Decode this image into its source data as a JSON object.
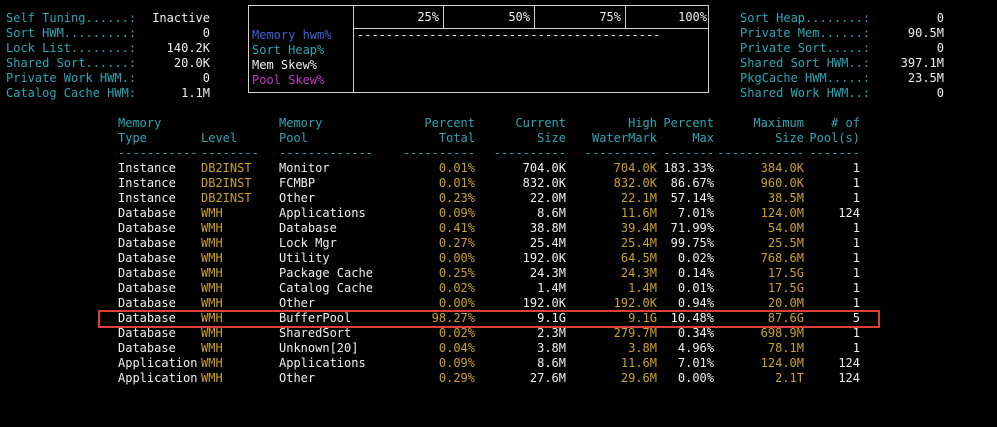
{
  "left_stats": [
    {
      "label": "Self Tuning......:",
      "value": "Inactive"
    },
    {
      "label": "Sort HWM.........:",
      "value": "0"
    },
    {
      "label": "Lock List........:",
      "value": "140.2K"
    },
    {
      "label": "Shared Sort......:",
      "value": "20.0K"
    },
    {
      "label": "Private Work HWM.:",
      "value": "0"
    },
    {
      "label": "Catalog Cache HWM:",
      "value": "1.1M"
    }
  ],
  "center_box": {
    "scale": [
      "25%",
      "50%",
      "75%",
      "100%"
    ],
    "legend": [
      {
        "label": "Memory hwm%",
        "color": "#3f63d6"
      },
      {
        "label": "Sort Heap%",
        "color": "#2aa7b3"
      },
      {
        "label": "Mem Skew%",
        "color": "#f0f0f0"
      },
      {
        "label": "Pool Skew%",
        "color": "#c238c2"
      }
    ],
    "hwm_bar": "------------------------------------------"
  },
  "right_stats": [
    {
      "label": "Sort Heap........:",
      "value": "0"
    },
    {
      "label": "Private Mem......:",
      "value": "90.5M"
    },
    {
      "label": "Private Sort.....:",
      "value": "0"
    },
    {
      "label": "Shared Sort HWM..:",
      "value": "397.1M"
    },
    {
      "label": "PkgCache HWM.....:",
      "value": "23.5M"
    },
    {
      "label": "Shared Work HWM..:",
      "value": "0"
    }
  ],
  "table": {
    "headers": [
      {
        "l1": "Memory",
        "l2": "Type"
      },
      {
        "l1": "",
        "l2": "Level"
      },
      {
        "l1": "Memory",
        "l2": "Pool"
      },
      {
        "l1": "Percent",
        "l2": "Total"
      },
      {
        "l1": "Current",
        "l2": "Size"
      },
      {
        "l1": "High",
        "l2": "WaterMark"
      },
      {
        "l1": "Percent",
        "l2": "Max"
      },
      {
        "l1": "Maximum",
        "l2": "Size"
      },
      {
        "l1": "# of",
        "l2": "Pool(s)"
      }
    ],
    "separators": [
      "-----------",
      "--------",
      "-------------",
      "----------",
      "----------",
      "----------",
      "-------",
      "------------",
      "-------"
    ],
    "rows": [
      [
        "Instance",
        "DB2INST",
        "Monitor",
        "0.01%",
        "704.0K",
        "704.0K",
        "183.33%",
        "384.0K",
        "1"
      ],
      [
        "Instance",
        "DB2INST",
        "FCMBP",
        "0.01%",
        "832.0K",
        "832.0K",
        "86.67%",
        "960.0K",
        "1"
      ],
      [
        "Instance",
        "DB2INST",
        "Other",
        "0.23%",
        "22.0M",
        "22.1M",
        "57.14%",
        "38.5M",
        "1"
      ],
      [
        "Database",
        "WMH",
        "Applications",
        "0.09%",
        "8.6M",
        "11.6M",
        "7.01%",
        "124.0M",
        "124"
      ],
      [
        "Database",
        "WMH",
        "Database",
        "0.41%",
        "38.8M",
        "39.4M",
        "71.99%",
        "54.0M",
        "1"
      ],
      [
        "Database",
        "WMH",
        "Lock Mgr",
        "0.27%",
        "25.4M",
        "25.4M",
        "99.75%",
        "25.5M",
        "1"
      ],
      [
        "Database",
        "WMH",
        "Utility",
        "0.00%",
        "192.0K",
        "64.5M",
        "0.02%",
        "768.6M",
        "1"
      ],
      [
        "Database",
        "WMH",
        "Package Cache",
        "0.25%",
        "24.3M",
        "24.3M",
        "0.14%",
        "17.5G",
        "1"
      ],
      [
        "Database",
        "WMH",
        "Catalog Cache",
        "0.02%",
        "1.4M",
        "1.4M",
        "0.01%",
        "17.5G",
        "1"
      ],
      [
        "Database",
        "WMH",
        "Other",
        "0.00%",
        "192.0K",
        "192.0K",
        "0.94%",
        "20.0M",
        "1"
      ],
      [
        "Database",
        "WMH",
        "BufferPool",
        "98.27%",
        "9.1G",
        "9.1G",
        "10.48%",
        "87.6G",
        "5"
      ],
      [
        "Database",
        "WMH",
        "SharedSort",
        "0.02%",
        "2.3M",
        "279.7M",
        "0.34%",
        "698.9M",
        "1"
      ],
      [
        "Database",
        "WMH",
        "Unknown[20]",
        "0.04%",
        "3.8M",
        "3.8M",
        "4.96%",
        "78.1M",
        "1"
      ],
      [
        "Application",
        "WMH",
        "Applications",
        "0.09%",
        "8.6M",
        "11.6M",
        "7.01%",
        "124.0M",
        "124"
      ],
      [
        "Application",
        "WMH",
        "Other",
        "0.29%",
        "27.6M",
        "29.6M",
        "0.00%",
        "2.1T",
        "124"
      ]
    ],
    "highlighted_row": 10,
    "highlight_color": "#e0403a"
  }
}
